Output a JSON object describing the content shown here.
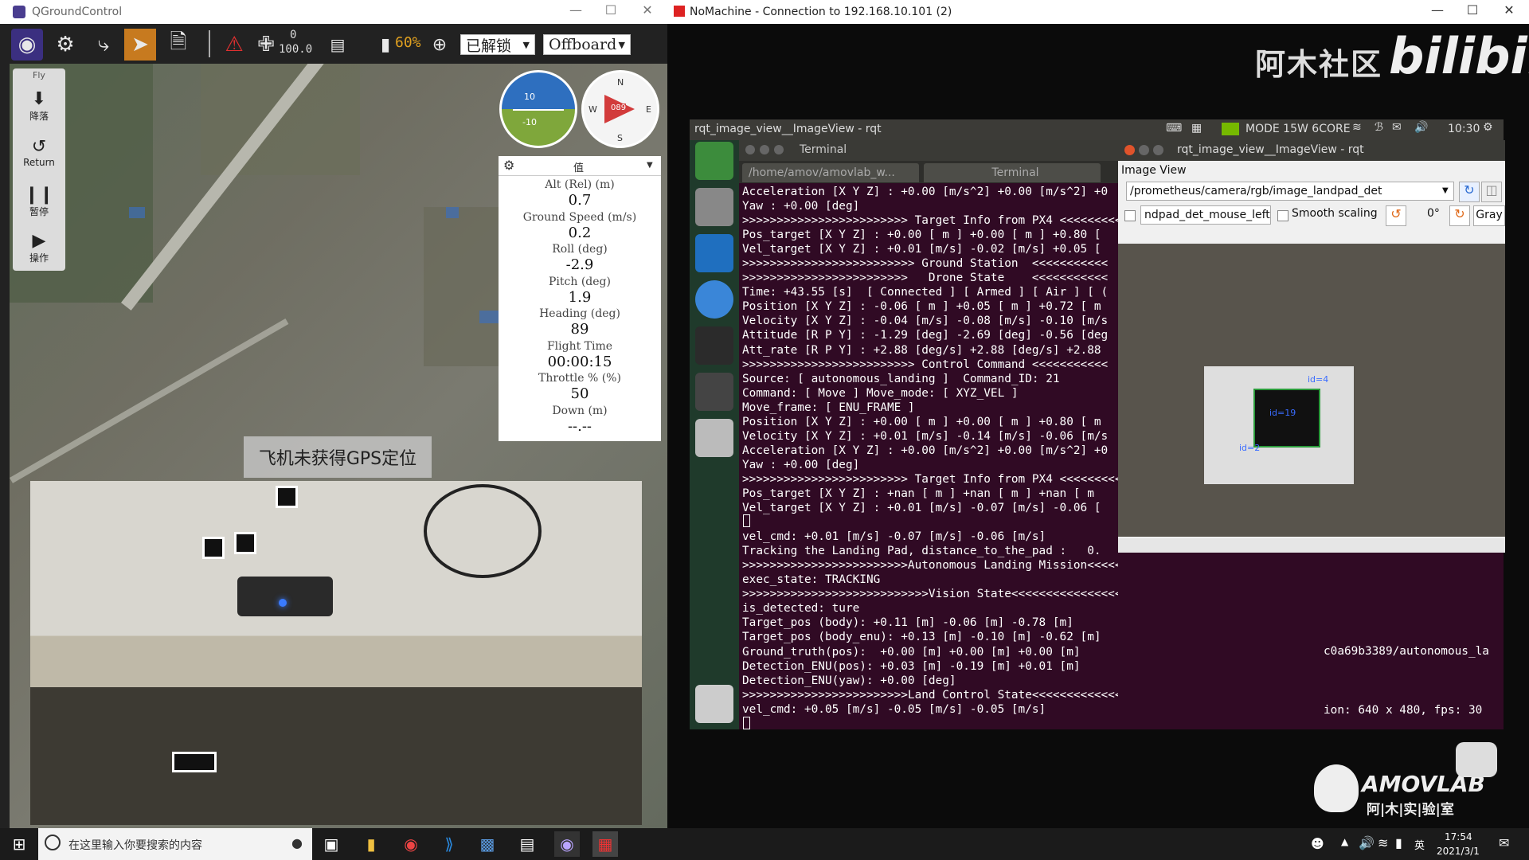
{
  "qgc": {
    "title": "QGroundControl",
    "toolbar": {
      "link_top": "0",
      "link_bottom": "100.0",
      "battery": "60%",
      "arm_state": "已解锁",
      "flight_mode": "Offboard"
    },
    "flybar": {
      "header": "Fly",
      "land": "降落",
      "return": "Return",
      "pause": "暂停",
      "action": "操作"
    },
    "compass": {
      "heading": "089",
      "n": "N",
      "e": "E",
      "s": "S",
      "w": "W"
    },
    "attitude": {
      "pitch_up": "10",
      "pitch_down": "-10"
    },
    "values": {
      "header": "值",
      "items": [
        {
          "label": "Alt (Rel) (m)",
          "value": "0.7"
        },
        {
          "label": "Ground Speed (m/s)",
          "value": "0.2"
        },
        {
          "label": "Roll (deg)",
          "value": "-2.9"
        },
        {
          "label": "Pitch (deg)",
          "value": "1.9"
        },
        {
          "label": "Heading (deg)",
          "value": "89"
        },
        {
          "label": "Flight Time",
          "value": "00:00:15"
        },
        {
          "label": "Throttle % (%)",
          "value": "50"
        },
        {
          "label": "Down (m)",
          "value": "--.--"
        }
      ]
    },
    "gps_banner": "飞机未获得GPS定位"
  },
  "nomachine": {
    "title": "NoMachine - Connection to 192.168.10.101 (2)",
    "watermark_cn": "阿木社区",
    "watermark_bili": "bilibili"
  },
  "ubuntu_panel": {
    "title": "rqt_image_view__ImageView - rqt",
    "mode": "MODE 15W 6CORE",
    "time": "10:30"
  },
  "terminal": {
    "window_title": "Terminal",
    "tab1": "/home/amov/amovlab_w...",
    "tab2": "Terminal",
    "lines": [
      "Acceleration [X Y Z] : +0.00 [m/s^2] +0.00 [m/s^2] +0",
      "Yaw : +0.00 [deg]",
      ">>>>>>>>>>>>>>>>>>>>>>>> Target Info from PX4 <<<<<<<<<",
      "Pos_target [X Y Z] : +0.00 [ m ] +0.00 [ m ] +0.80 [",
      "Vel_target [X Y Z] : +0.01 [m/s] -0.02 [m/s] +0.05 [",
      ">>>>>>>>>>>>>>>>>>>>>>>>> Ground Station  <<<<<<<<<<<",
      ">>>>>>>>>>>>>>>>>>>>>>>>   Drone State    <<<<<<<<<<<",
      "Time: +43.55 [s]  [ Connected ] [ Armed ] [ Air ] [ (",
      "Position [X Y Z] : -0.06 [ m ] +0.05 [ m ] +0.72 [ m",
      "Velocity [X Y Z] : -0.04 [m/s] -0.08 [m/s] -0.10 [m/s",
      "Attitude [R P Y] : -1.29 [deg] -2.69 [deg] -0.56 [deg",
      "Att_rate [R P Y] : +2.88 [deg/s] +2.88 [deg/s] +2.88",
      ">>>>>>>>>>>>>>>>>>>>>>>>> Control Command <<<<<<<<<<<",
      "Source: [ autonomous_landing ]  Command_ID: 21",
      "Command: [ Move ] Move_mode: [ XYZ_VEL ]",
      "Move_frame: [ ENU_FRAME ]",
      "Position [X Y Z] : +0.00 [ m ] +0.00 [ m ] +0.80 [ m",
      "Velocity [X Y Z] : +0.01 [m/s] -0.14 [m/s] -0.06 [m/s",
      "Acceleration [X Y Z] : +0.00 [m/s^2] +0.00 [m/s^2] +0",
      "Yaw : +0.00 [deg]",
      ">>>>>>>>>>>>>>>>>>>>>>>> Target Info from PX4 <<<<<<<<<",
      "Pos_target [X Y Z] : +nan [ m ] +nan [ m ] +nan [ m",
      "Vel_target [X Y Z] : +0.01 [m/s] -0.07 [m/s] -0.06 [",
      "",
      "vel_cmd: +0.01 [m/s] -0.07 [m/s] -0.06 [m/s]",
      "Tracking the Landing Pad, distance_to_the_pad :   0.",
      ">>>>>>>>>>>>>>>>>>>>>>>>Autonomous Landing Mission<<<<<<<<<<<<<<<<<<",
      "exec_state: TRACKING",
      ">>>>>>>>>>>>>>>>>>>>>>>>>>>Vision State<<<<<<<<<<<<<<<<<<<<<<<<<<<<",
      "is_detected: ture",
      "Target_pos (body): +0.11 [m] -0.06 [m] -0.78 [m]",
      "Target_pos (body_enu): +0.13 [m] -0.10 [m] -0.62 [m]",
      "Ground_truth(pos):  +0.00 [m] +0.00 [m] +0.00 [m]",
      "Detection_ENU(pos): +0.03 [m] -0.19 [m] +0.01 [m]",
      "Detection_ENU(yaw): +0.00 [deg]",
      ">>>>>>>>>>>>>>>>>>>>>>>>Land Control State<<<<<<<<<<<<<<<<<<<<<<<<<",
      "vel_cmd: +0.05 [m/s] -0.05 [m/s] -0.05 [m/s]"
    ],
    "right_line1": "c0a69b3389/autonomous_la",
    "right_line2": "ion: 640 x 480, fps: 30"
  },
  "rqt": {
    "title": "rqt_image_view__ImageView - rqt",
    "plugin": "Image View",
    "topic": "/prometheus/camera/rgb/image_landpad_det",
    "mouse_topic": "ndpad_det_mouse_left",
    "smooth_label": "Smooth scaling",
    "rotation": "0°",
    "gray": "Gray",
    "marker_id4": "id=4",
    "marker_id19": "id=19",
    "marker_id2": "id=2"
  },
  "amovlab": {
    "name": "AMOVLAB",
    "cn": "阿|木|实|验|室"
  },
  "taskbar": {
    "search_placeholder": "在这里输入你要搜索的内容",
    "time": "17:54",
    "date": "2021/3/1",
    "ime": "英"
  }
}
